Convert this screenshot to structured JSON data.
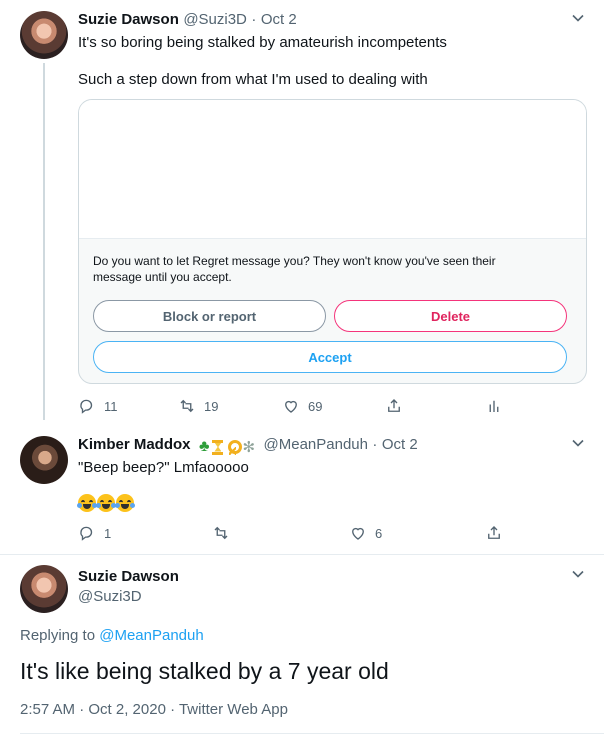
{
  "tweet1": {
    "name": "Suzie Dawson",
    "handle": "@Suzi3D",
    "date": "Oct 2",
    "line1": "It's so boring being stalked by amateurish incompetents",
    "line2": "Such a step down from what I'm used to dealing with",
    "card": {
      "message": "Do you want to let Regret message you? They won't know you've seen their message until you accept.",
      "block_label": "Block or report",
      "delete_label": "Delete",
      "accept_label": "Accept"
    },
    "replies": "11",
    "retweets": "19",
    "likes": "69"
  },
  "tweet2": {
    "name": "Kimber Maddox",
    "handle": "@MeanPanduh",
    "date": "Oct 2",
    "text": "\"Beep beep?\" Lmfaooooo",
    "replies": "1",
    "likes": "6"
  },
  "tweet3": {
    "name": "Suzie Dawson",
    "handle": "@Suzi3D",
    "replying_prefix": "Replying to",
    "replying_handle": "@MeanPanduh",
    "text": "It's like being stalked by a 7 year old",
    "meta": "2:57 AM · Oct 2, 2020 · Twitter Web App"
  },
  "separator": "·",
  "icons": {
    "chevron": "chevron-down-icon",
    "reply": "reply-icon",
    "retweet": "retweet-icon",
    "like": "heart-icon",
    "share": "share-icon",
    "analytics": "analytics-icon"
  },
  "colors": {
    "link": "#1da1f2",
    "delete": "#e0245e",
    "muted": "#536471"
  }
}
